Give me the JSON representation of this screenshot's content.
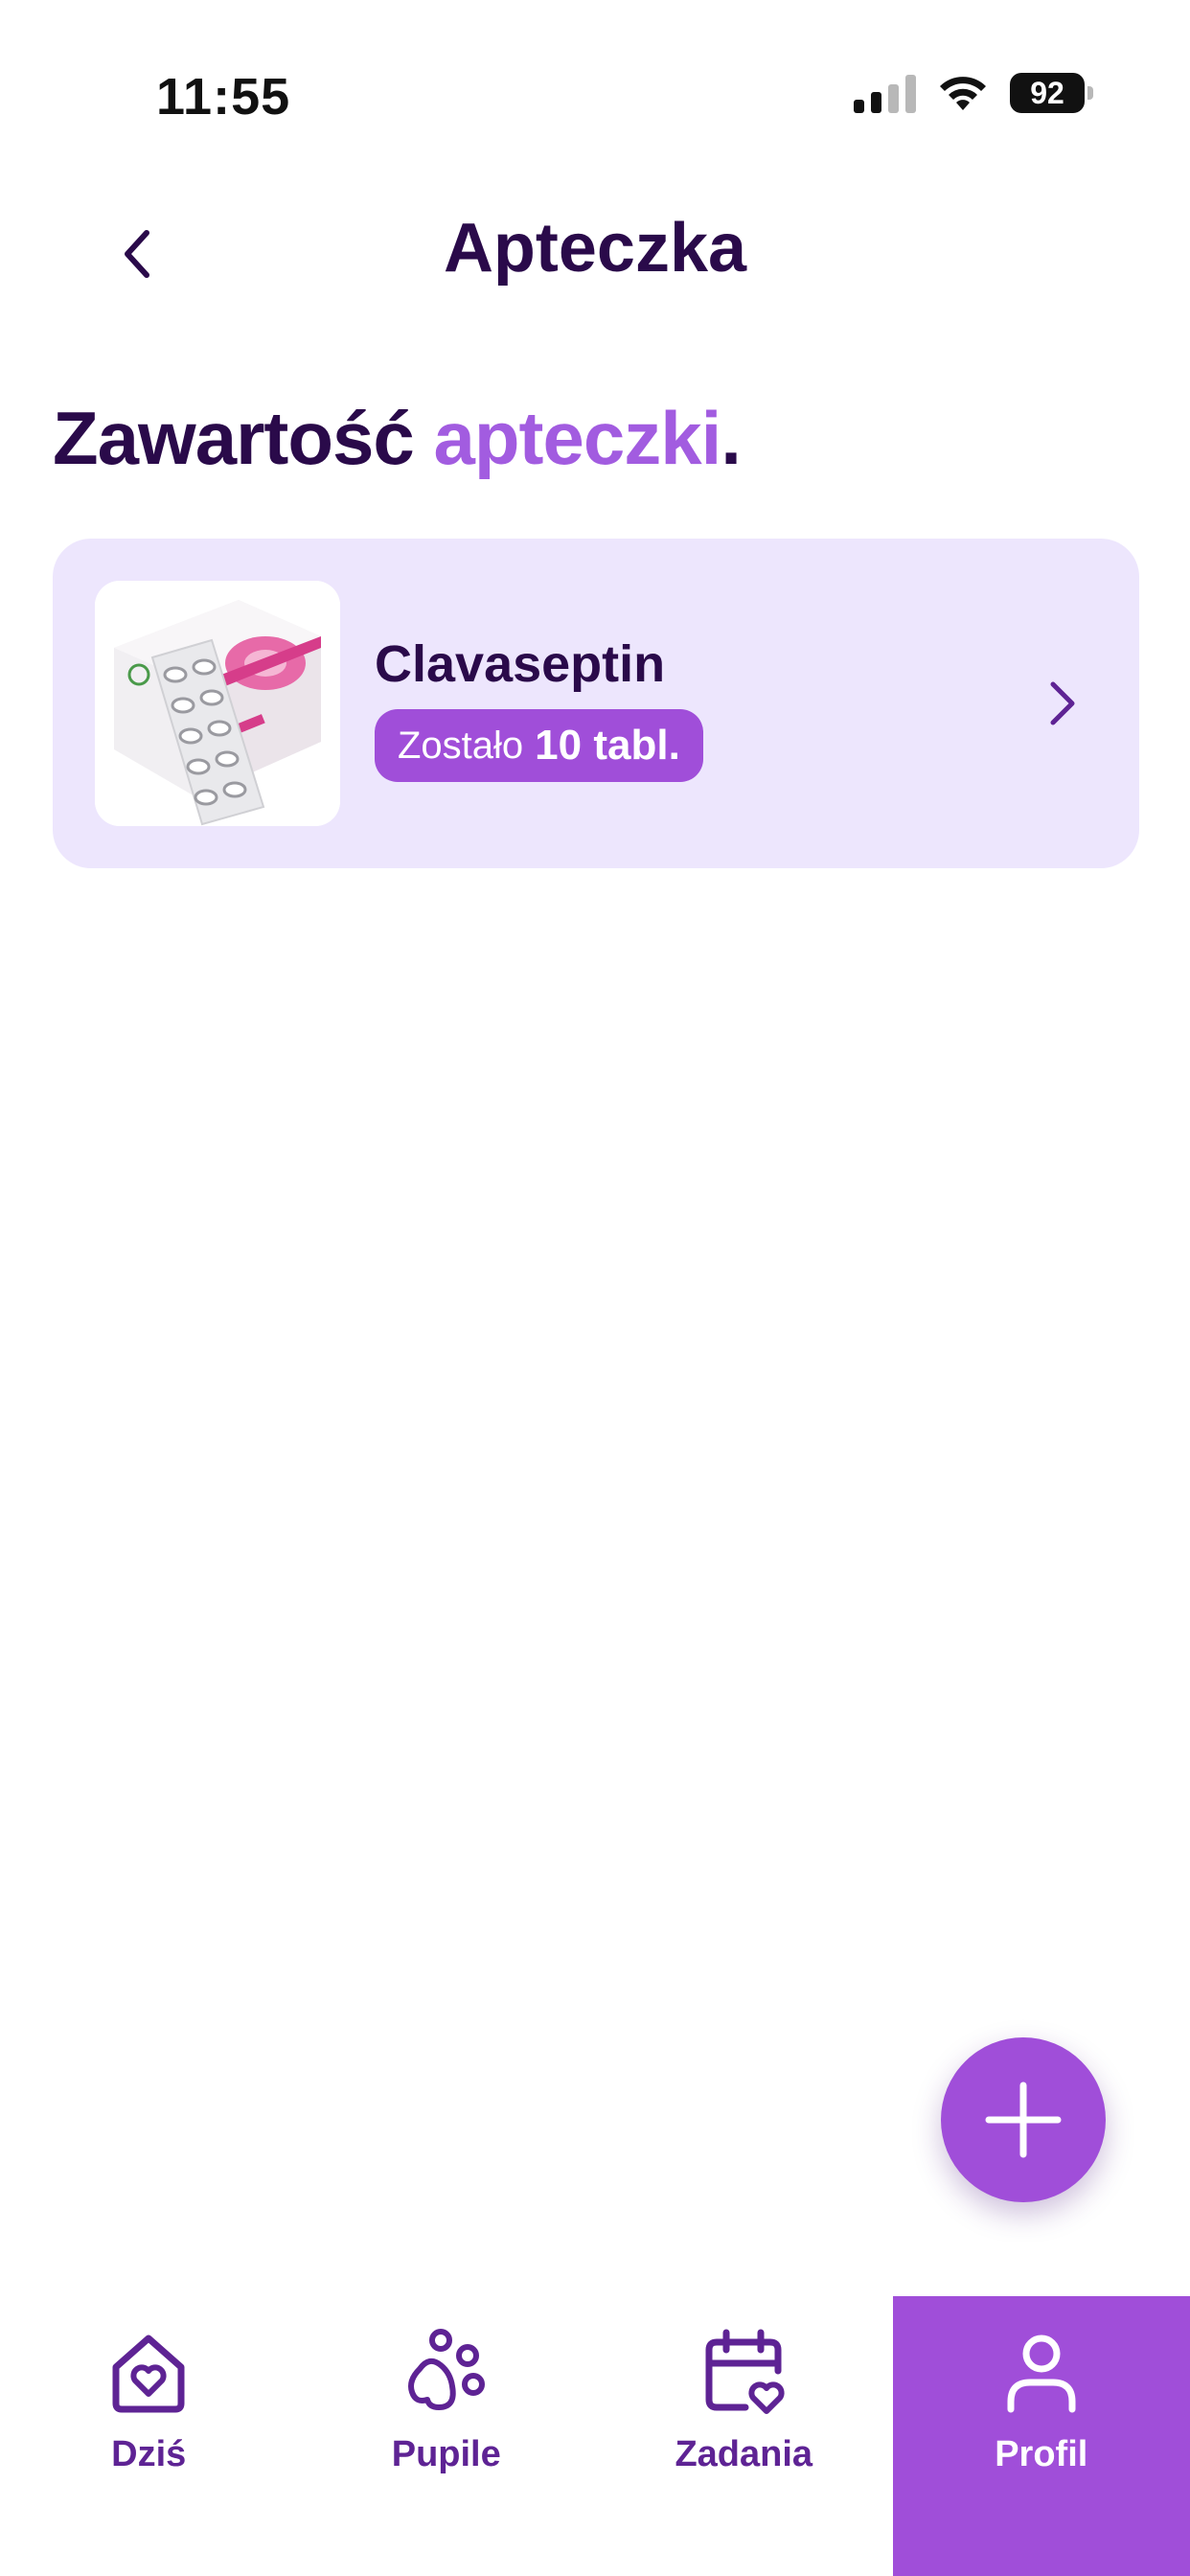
{
  "status_bar": {
    "time": "11:55",
    "battery": "92",
    "icons": [
      "signal-icon",
      "wifi-icon",
      "battery-icon"
    ]
  },
  "header": {
    "title": "Apteczka",
    "back_icon": "chevron-left-icon"
  },
  "section": {
    "heading_main": "Zawartość",
    "heading_accent": "apteczki",
    "heading_dot": "."
  },
  "medications": [
    {
      "name": "Clavaseptin",
      "badge_prefix": "Zostało",
      "badge_amount": "10 tabl.",
      "thumbnail": "medicine-box-image",
      "chevron": "chevron-right-icon"
    }
  ],
  "fab": {
    "icon": "plus-icon"
  },
  "tabs": [
    {
      "label": "Dziś",
      "icon": "home-heart-icon",
      "active": false
    },
    {
      "label": "Pupile",
      "icon": "paw-icon",
      "active": false
    },
    {
      "label": "Zadania",
      "icon": "calendar-heart-icon",
      "active": false
    },
    {
      "label": "Profil",
      "icon": "user-icon",
      "active": true
    }
  ],
  "colors": {
    "primary": "#a04ed9",
    "accent_text": "#a25ce0",
    "dark_text": "#2a0a4a",
    "card_bg": "#ede6fd",
    "tab_inactive": "#5e2394"
  }
}
